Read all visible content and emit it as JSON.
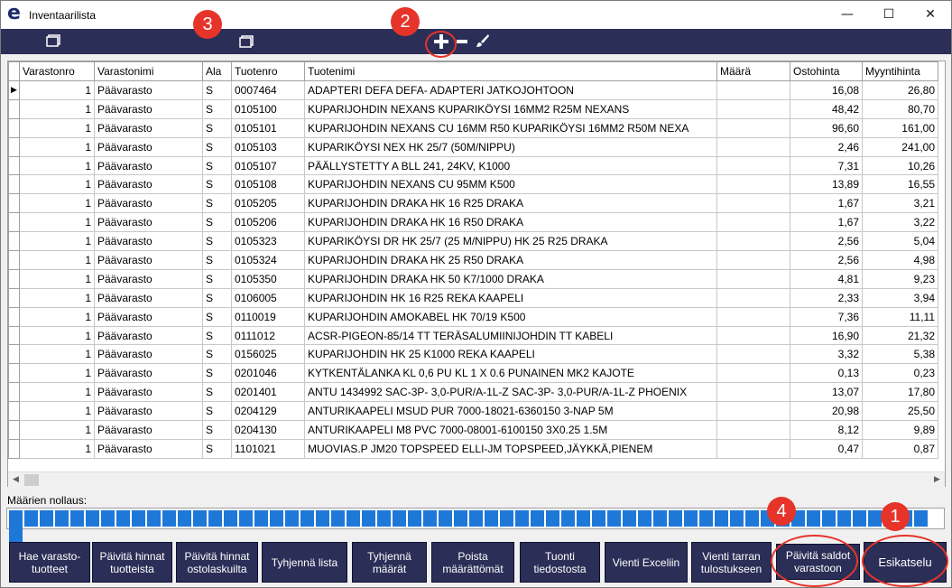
{
  "window": {
    "title": "Inventaarilista",
    "app_icon": "e",
    "minimize": "—",
    "maximize": "☐",
    "close": "✕"
  },
  "toolbar": {
    "icons": [
      "window-icon",
      "window-icon",
      "plus-icon",
      "minus-icon",
      "brush-icon"
    ]
  },
  "grid": {
    "columns": [
      "Varastonro",
      "Varastonimi",
      "Ala",
      "Tuotenro",
      "Tuotenimi",
      "Määrä",
      "Ostohinta",
      "Myyntihinta"
    ],
    "rows": [
      [
        "1",
        "Päävarasto",
        "S",
        "0007464",
        "ADAPTERI DEFA DEFA- ADAPTERI JATKOJOHTOON",
        "",
        "16,08",
        "26,80"
      ],
      [
        "1",
        "Päävarasto",
        "S",
        "0105100",
        "KUPARIJOHDIN NEXANS KUPARIKÖYSI 16MM2 R25M NEXANS",
        "",
        "48,42",
        "80,70"
      ],
      [
        "1",
        "Päävarasto",
        "S",
        "0105101",
        "KUPARIJOHDIN NEXANS CU 16MM R50 KUPARIKÖYSI 16MM2 R50M NEXA",
        "",
        "96,60",
        "161,00"
      ],
      [
        "1",
        "Päävarasto",
        "S",
        "0105103",
        "KUPARIKÖYSI NEX HK 25/7 (50M/NIPPU)",
        "",
        "2,46",
        "241,00"
      ],
      [
        "1",
        "Päävarasto",
        "S",
        "0105107",
        "PÄÄLLYSTETTY A BLL 241, 24KV, K1000",
        "",
        "7,31",
        "10,26"
      ],
      [
        "1",
        "Päävarasto",
        "S",
        "0105108",
        "KUPARIJOHDIN NEXANS CU 95MM K500",
        "",
        "13,89",
        "16,55"
      ],
      [
        "1",
        "Päävarasto",
        "S",
        "0105205",
        "KUPARIJOHDIN DRAKA HK 16 R25 DRAKA",
        "",
        "1,67",
        "3,21"
      ],
      [
        "1",
        "Päävarasto",
        "S",
        "0105206",
        "KUPARIJOHDIN DRAKA HK 16 R50 DRAKA",
        "",
        "1,67",
        "3,22"
      ],
      [
        "1",
        "Päävarasto",
        "S",
        "0105323",
        "KUPARIKÖYSI DR HK 25/7 (25 M/NIPPU) HK 25 R25 DRAKA",
        "",
        "2,56",
        "5,04"
      ],
      [
        "1",
        "Päävarasto",
        "S",
        "0105324",
        "KUPARIJOHDIN DRAKA HK 25 R50 DRAKA",
        "",
        "2,56",
        "4,98"
      ],
      [
        "1",
        "Päävarasto",
        "S",
        "0105350",
        "KUPARIJOHDIN DRAKA HK 50 K7/1000 DRAKA",
        "",
        "4,81",
        "9,23"
      ],
      [
        "1",
        "Päävarasto",
        "S",
        "0106005",
        "KUPARIJOHDIN HK 16 R25 REKA KAAPELI",
        "",
        "2,33",
        "3,94"
      ],
      [
        "1",
        "Päävarasto",
        "S",
        "0110019",
        "KUPARIJOHDIN AMOKABEL HK 70/19 K500",
        "",
        "7,36",
        "11,11"
      ],
      [
        "1",
        "Päävarasto",
        "S",
        "0111012",
        "ACSR-PIGEON-85/14 TT TERÄSALUMIINIJOHDIN TT KABELI",
        "",
        "16,90",
        "21,32"
      ],
      [
        "1",
        "Päävarasto",
        "S",
        "0156025",
        "KUPARIJOHDIN HK 25 K1000 REKA KAAPELI",
        "",
        "3,32",
        "5,38"
      ],
      [
        "1",
        "Päävarasto",
        "S",
        "0201046",
        "KYTKENTÄLANKA KL 0,6 PU KL 1 X 0.6 PUNAINEN MK2 KAJOTE",
        "",
        "0,13",
        "0,23"
      ],
      [
        "1",
        "Päävarasto",
        "S",
        "0201401",
        "ANTU 1434992 SAC-3P- 3,0-PUR/A-1L-Z SAC-3P- 3,0-PUR/A-1L-Z PHOENIX",
        "",
        "13,07",
        "17,80"
      ],
      [
        "1",
        "Päävarasto",
        "S",
        "0204129",
        "ANTURIKAAPELI MSUD PUR 7000-18021-6360150 3-NAP 5M",
        "",
        "20,98",
        "25,50"
      ],
      [
        "1",
        "Päävarasto",
        "S",
        "0204130",
        "ANTURIKAAPELI M8 PVC 7000-08001-6100150 3X0.25 1.5M",
        "",
        "8,12",
        "9,89"
      ],
      [
        "1",
        "Päävarasto",
        "S",
        "1101021",
        "MUOVIAS.P JM20 TOPSPEED ELLI-JM TOPSPEED,JÄYKKÄ,PIENEM",
        "",
        "0,47",
        "0,87"
      ]
    ]
  },
  "reset_section": {
    "label": "Määrien nollaus:",
    "progress": 1.0
  },
  "buttons": [
    "Hae varasto-\ntuotteet",
    "Päivitä hinnat\ntuotteista",
    "Päivitä hinnat\nostolaskuilta",
    "Tyhjennä lista",
    "Tyhjennä\nmäärät",
    "Poista\nmäärättömät",
    "Tuonti\ntiedostosta",
    "Vienti Exceliin",
    "Vienti tarran\ntulostukseen",
    "Päivitä saldot\nvarastoon",
    "Esikatselu"
  ],
  "annotations": [
    "1",
    "2",
    "3",
    "4"
  ],
  "colors": {
    "toolbar_bg": "#2b2f57",
    "button_bg": "#2b2f57",
    "progress_fill": "#1e78d8",
    "annotation_red": "#e6342a"
  }
}
